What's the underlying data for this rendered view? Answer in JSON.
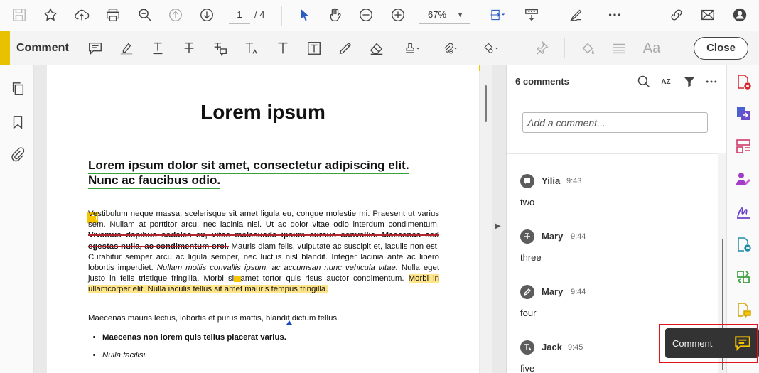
{
  "toolbar": {
    "page_current": "1",
    "page_total": "/ 4",
    "zoom": "67%"
  },
  "comment_toolbar": {
    "title": "Comment",
    "close_label": "Close",
    "text_properties_label": "Aa"
  },
  "document": {
    "heading": "Lorem ipsum",
    "subheading": "Lorem ipsum dolor sit amet, consectetur adipiscing elit. Nunc ac faucibus odio.",
    "para1_pre": "Vestibulum neque massa, scelerisque sit amet ligula eu, congue molestie mi. Praesent ut varius sem. Nullam at porttitor arcu, nec lacinia nisi. Ut ac dolor vitae odio interdum condimentum. ",
    "para1_strike": "Vivamus dapibus sodales ex, vitae malesuada ipsum cursus convallis. Maecenas sed egestas nulla, ac condimentum orci.",
    "para1_mid": " Mauris diam felis, vulputate ac suscipit et, iaculis non est. Curabitur semper arcu ac ligula semper, nec luctus nisl blandit. Integer lacinia ante ac libero lobortis imperdiet. ",
    "para1_italic": "Nullam mollis convallis ipsum, ac accumsan nunc vehicula vitae.",
    "para1_post": " Nulla eget justo in felis tristique fringilla. Morbi sit amet tortor quis risus auctor condimentum. ",
    "para1_highlight": "Morbi in ullamcorper elit. Nulla iaculis tellus sit amet mauris tempus fringilla.",
    "para2": "Maecenas mauris lectus, lobortis et purus mattis, blandit dictum tellus.",
    "bullet1": "Maecenas non lorem quis tellus placerat varius.",
    "bullet2": "Nulla facilisi."
  },
  "comments_panel": {
    "count_label": "6 comments",
    "add_placeholder": "Add a comment...",
    "sort_label": "AZ",
    "comments": [
      {
        "author": "Yilia",
        "time": "9:43",
        "body": "two",
        "type_icon": "sticky-note-icon"
      },
      {
        "author": "Mary",
        "time": "9:44",
        "body": "three",
        "type_icon": "strikethrough-icon"
      },
      {
        "author": "Mary",
        "time": "9:44",
        "body": "four",
        "type_icon": "pen-icon"
      },
      {
        "author": "Jack",
        "time": "9:45",
        "body": "five",
        "type_icon": "text-insert-icon"
      }
    ]
  },
  "tooltip": {
    "label": "Comment"
  },
  "colors": {
    "accent_yellow": "#e8c200",
    "highlight": "#ffe58a",
    "strike_red": "#b3262e",
    "underline_green": "#3aa23a",
    "selection_red": "#e0141b",
    "tool_blue": "#2a5cc0"
  }
}
